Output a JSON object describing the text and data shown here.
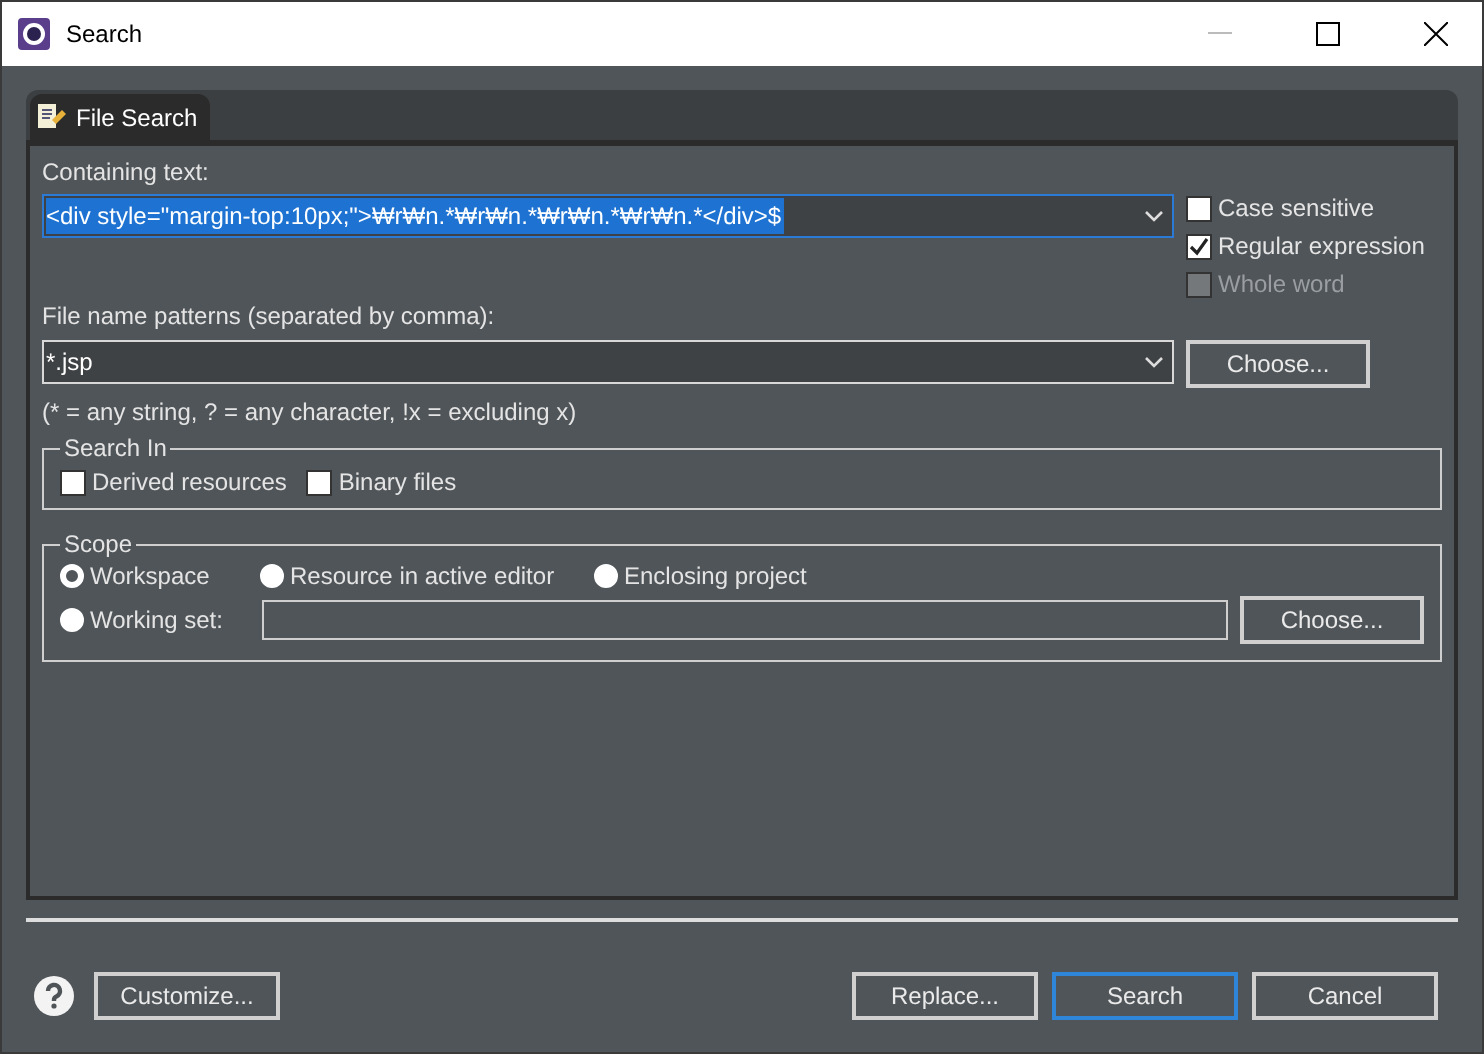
{
  "window": {
    "title": "Search"
  },
  "tabs": [
    {
      "label": "File Search",
      "selected": true
    }
  ],
  "containing_text": {
    "label": "Containing text:",
    "value": "<div style=\"margin-top:10px;\">₩r₩n.*₩r₩n.*₩r₩n.*₩r₩n.*</div>$"
  },
  "options": [
    {
      "label": "Case sensitive",
      "checked": false,
      "disabled": false
    },
    {
      "label": "Regular expression",
      "checked": true,
      "disabled": false
    },
    {
      "label": "Whole word",
      "checked": false,
      "disabled": true
    }
  ],
  "file_patterns": {
    "label": "File name patterns (separated by comma):",
    "value": "*.jsp",
    "button": "Choose...",
    "hint": "(* = any string, ? = any character, !x = excluding x)"
  },
  "search_in": {
    "title": "Search In",
    "items": [
      {
        "label": "Derived resources",
        "checked": false
      },
      {
        "label": "Binary files",
        "checked": false
      }
    ]
  },
  "scope": {
    "title": "Scope",
    "items": [
      {
        "label": "Workspace",
        "selected": true
      },
      {
        "label": "Resource in active editor",
        "selected": false
      },
      {
        "label": "Enclosing project",
        "selected": false
      },
      {
        "label": "Working set:",
        "selected": false
      }
    ],
    "button": "Choose..."
  },
  "footer": {
    "left": "Customize...",
    "buttons": [
      {
        "label": "Replace...",
        "default": false
      },
      {
        "label": "Search",
        "default": true
      },
      {
        "label": "Cancel",
        "default": false
      }
    ]
  }
}
